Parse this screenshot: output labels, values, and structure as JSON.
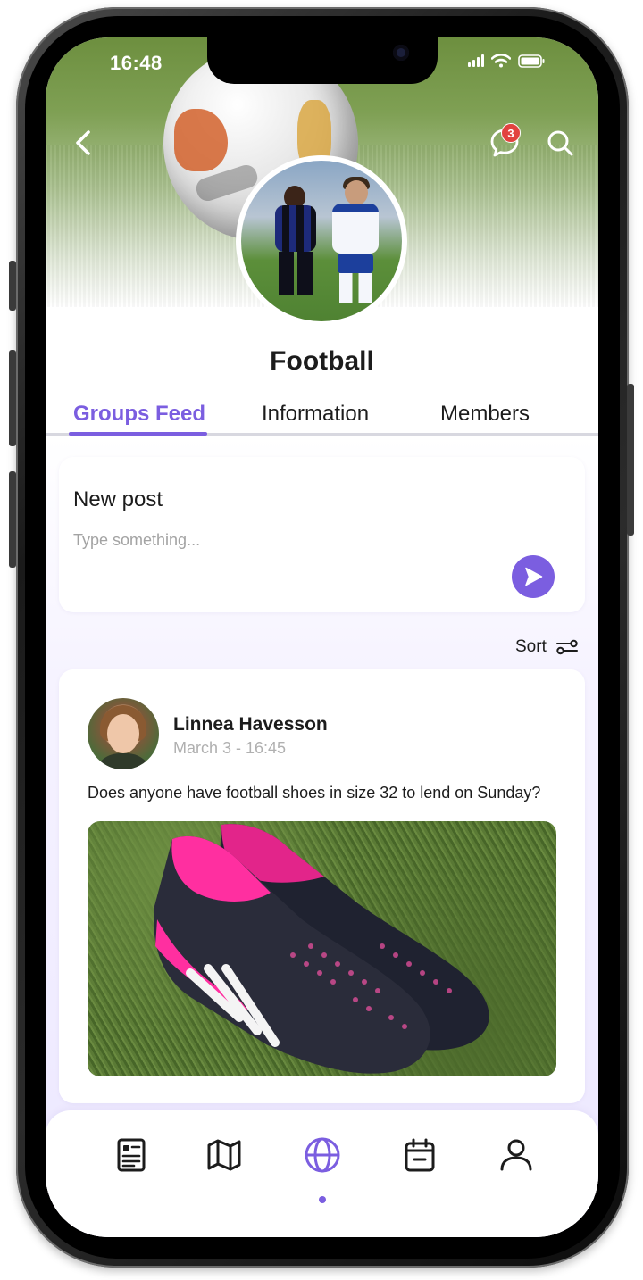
{
  "status_bar": {
    "time": "16:48"
  },
  "header": {
    "notification_count": "3",
    "group_name": "Football"
  },
  "tabs": [
    {
      "label": "Groups Feed",
      "active": true
    },
    {
      "label": "Information",
      "active": false
    },
    {
      "label": "Members",
      "active": false
    }
  ],
  "new_post": {
    "title": "New post",
    "placeholder": "Type something..."
  },
  "sort": {
    "label": "Sort"
  },
  "post": {
    "author": "Linnea Havesson",
    "timestamp": "March 3 - 16:45",
    "text": "Does anyone have football shoes in size 32 to lend on Sunday?"
  },
  "bottom_nav": {
    "items": [
      "news-icon",
      "map-icon",
      "globe-icon",
      "calendar-icon",
      "profile-icon"
    ],
    "active": "globe-icon"
  },
  "colors": {
    "accent": "#7b5ee0",
    "badge": "#e2433f",
    "text": "#1c1c1c",
    "muted": "#a3a3a3"
  }
}
